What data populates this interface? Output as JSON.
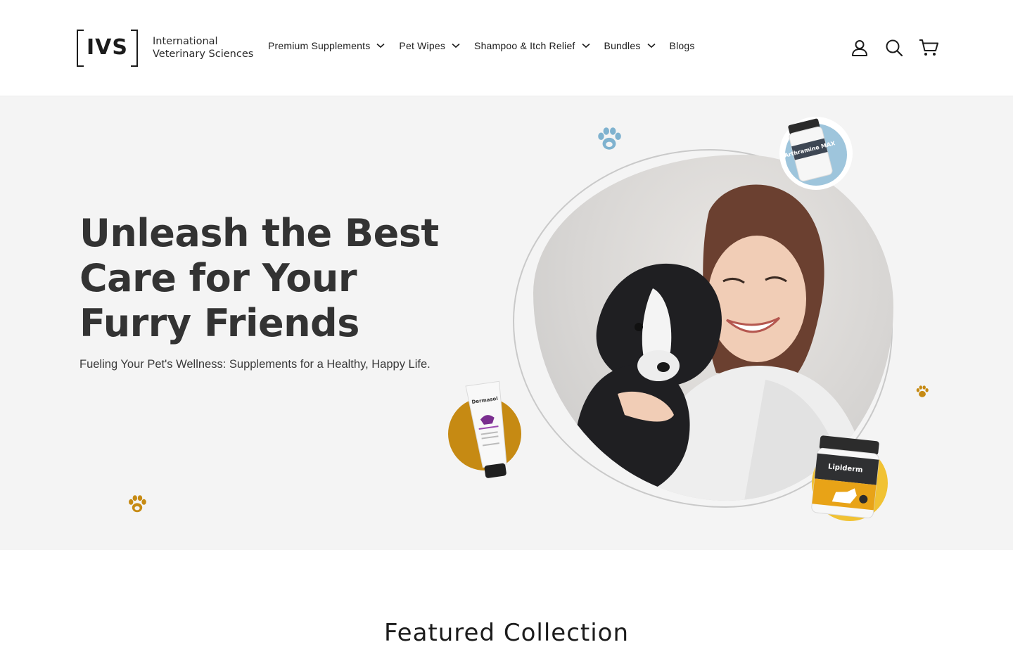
{
  "brand": {
    "mark": "IVS",
    "name_line1": "International",
    "name_line2": "Veterinary Sciences"
  },
  "nav": {
    "items": [
      {
        "label": "Premium Supplements",
        "has_dropdown": true
      },
      {
        "label": "Pet Wipes",
        "has_dropdown": true
      },
      {
        "label": "Shampoo & Itch Relief",
        "has_dropdown": true
      },
      {
        "label": "Bundles",
        "has_dropdown": true
      },
      {
        "label": "Blogs",
        "has_dropdown": false
      }
    ]
  },
  "header_icons": [
    "account-icon",
    "search-icon",
    "cart-icon"
  ],
  "hero": {
    "title": "Unleash the Best Care for Your Furry Friends",
    "subtitle": "Fueling Your Pet's Wellness: Supplements for a Healthy, Happy Life.",
    "products": {
      "top": "Arthramine MAX",
      "left": "Dermasol",
      "right": "Lipiderm"
    }
  },
  "featured": {
    "title": "Featured Collection"
  },
  "colors": {
    "hero_bg": "#f4f4f4",
    "accent_gold": "#c68a13",
    "accent_blue": "#7fb2cf",
    "text_dark": "#333333"
  }
}
